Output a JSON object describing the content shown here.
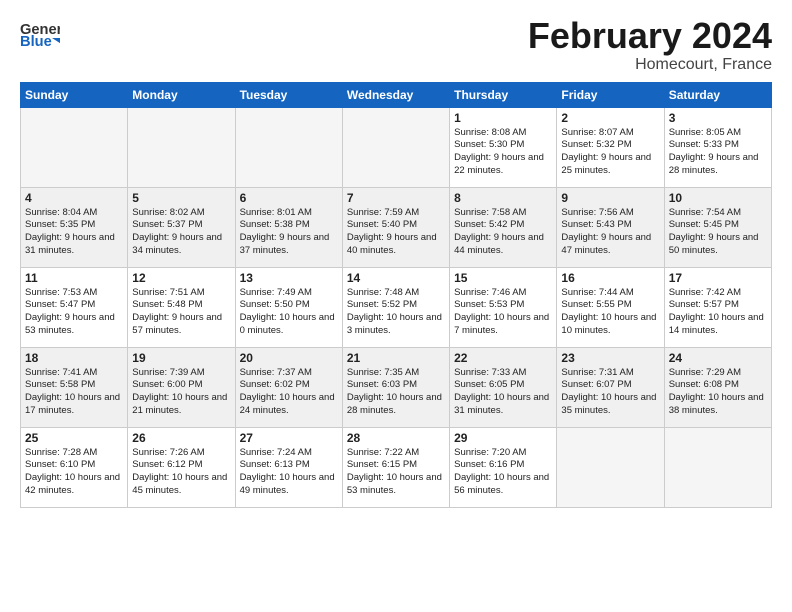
{
  "header": {
    "logo_general": "General",
    "logo_blue": "Blue",
    "month_title": "February 2024",
    "location": "Homecourt, France"
  },
  "days_of_week": [
    "Sunday",
    "Monday",
    "Tuesday",
    "Wednesday",
    "Thursday",
    "Friday",
    "Saturday"
  ],
  "weeks": [
    {
      "shade": false,
      "cells": [
        {
          "day": "",
          "empty": true
        },
        {
          "day": "",
          "empty": true
        },
        {
          "day": "",
          "empty": true
        },
        {
          "day": "",
          "empty": true
        },
        {
          "day": "1",
          "empty": false,
          "text": "Sunrise: 8:08 AM\nSunset: 5:30 PM\nDaylight: 9 hours\nand 22 minutes."
        },
        {
          "day": "2",
          "empty": false,
          "text": "Sunrise: 8:07 AM\nSunset: 5:32 PM\nDaylight: 9 hours\nand 25 minutes."
        },
        {
          "day": "3",
          "empty": false,
          "text": "Sunrise: 8:05 AM\nSunset: 5:33 PM\nDaylight: 9 hours\nand 28 minutes."
        }
      ]
    },
    {
      "shade": true,
      "cells": [
        {
          "day": "4",
          "empty": false,
          "text": "Sunrise: 8:04 AM\nSunset: 5:35 PM\nDaylight: 9 hours\nand 31 minutes."
        },
        {
          "day": "5",
          "empty": false,
          "text": "Sunrise: 8:02 AM\nSunset: 5:37 PM\nDaylight: 9 hours\nand 34 minutes."
        },
        {
          "day": "6",
          "empty": false,
          "text": "Sunrise: 8:01 AM\nSunset: 5:38 PM\nDaylight: 9 hours\nand 37 minutes."
        },
        {
          "day": "7",
          "empty": false,
          "text": "Sunrise: 7:59 AM\nSunset: 5:40 PM\nDaylight: 9 hours\nand 40 minutes."
        },
        {
          "day": "8",
          "empty": false,
          "text": "Sunrise: 7:58 AM\nSunset: 5:42 PM\nDaylight: 9 hours\nand 44 minutes."
        },
        {
          "day": "9",
          "empty": false,
          "text": "Sunrise: 7:56 AM\nSunset: 5:43 PM\nDaylight: 9 hours\nand 47 minutes."
        },
        {
          "day": "10",
          "empty": false,
          "text": "Sunrise: 7:54 AM\nSunset: 5:45 PM\nDaylight: 9 hours\nand 50 minutes."
        }
      ]
    },
    {
      "shade": false,
      "cells": [
        {
          "day": "11",
          "empty": false,
          "text": "Sunrise: 7:53 AM\nSunset: 5:47 PM\nDaylight: 9 hours\nand 53 minutes."
        },
        {
          "day": "12",
          "empty": false,
          "text": "Sunrise: 7:51 AM\nSunset: 5:48 PM\nDaylight: 9 hours\nand 57 minutes."
        },
        {
          "day": "13",
          "empty": false,
          "text": "Sunrise: 7:49 AM\nSunset: 5:50 PM\nDaylight: 10 hours\nand 0 minutes."
        },
        {
          "day": "14",
          "empty": false,
          "text": "Sunrise: 7:48 AM\nSunset: 5:52 PM\nDaylight: 10 hours\nand 3 minutes."
        },
        {
          "day": "15",
          "empty": false,
          "text": "Sunrise: 7:46 AM\nSunset: 5:53 PM\nDaylight: 10 hours\nand 7 minutes."
        },
        {
          "day": "16",
          "empty": false,
          "text": "Sunrise: 7:44 AM\nSunset: 5:55 PM\nDaylight: 10 hours\nand 10 minutes."
        },
        {
          "day": "17",
          "empty": false,
          "text": "Sunrise: 7:42 AM\nSunset: 5:57 PM\nDaylight: 10 hours\nand 14 minutes."
        }
      ]
    },
    {
      "shade": true,
      "cells": [
        {
          "day": "18",
          "empty": false,
          "text": "Sunrise: 7:41 AM\nSunset: 5:58 PM\nDaylight: 10 hours\nand 17 minutes."
        },
        {
          "day": "19",
          "empty": false,
          "text": "Sunrise: 7:39 AM\nSunset: 6:00 PM\nDaylight: 10 hours\nand 21 minutes."
        },
        {
          "day": "20",
          "empty": false,
          "text": "Sunrise: 7:37 AM\nSunset: 6:02 PM\nDaylight: 10 hours\nand 24 minutes."
        },
        {
          "day": "21",
          "empty": false,
          "text": "Sunrise: 7:35 AM\nSunset: 6:03 PM\nDaylight: 10 hours\nand 28 minutes."
        },
        {
          "day": "22",
          "empty": false,
          "text": "Sunrise: 7:33 AM\nSunset: 6:05 PM\nDaylight: 10 hours\nand 31 minutes."
        },
        {
          "day": "23",
          "empty": false,
          "text": "Sunrise: 7:31 AM\nSunset: 6:07 PM\nDaylight: 10 hours\nand 35 minutes."
        },
        {
          "day": "24",
          "empty": false,
          "text": "Sunrise: 7:29 AM\nSunset: 6:08 PM\nDaylight: 10 hours\nand 38 minutes."
        }
      ]
    },
    {
      "shade": false,
      "cells": [
        {
          "day": "25",
          "empty": false,
          "text": "Sunrise: 7:28 AM\nSunset: 6:10 PM\nDaylight: 10 hours\nand 42 minutes."
        },
        {
          "day": "26",
          "empty": false,
          "text": "Sunrise: 7:26 AM\nSunset: 6:12 PM\nDaylight: 10 hours\nand 45 minutes."
        },
        {
          "day": "27",
          "empty": false,
          "text": "Sunrise: 7:24 AM\nSunset: 6:13 PM\nDaylight: 10 hours\nand 49 minutes."
        },
        {
          "day": "28",
          "empty": false,
          "text": "Sunrise: 7:22 AM\nSunset: 6:15 PM\nDaylight: 10 hours\nand 53 minutes."
        },
        {
          "day": "29",
          "empty": false,
          "text": "Sunrise: 7:20 AM\nSunset: 6:16 PM\nDaylight: 10 hours\nand 56 minutes."
        },
        {
          "day": "",
          "empty": true
        },
        {
          "day": "",
          "empty": true
        }
      ]
    }
  ]
}
